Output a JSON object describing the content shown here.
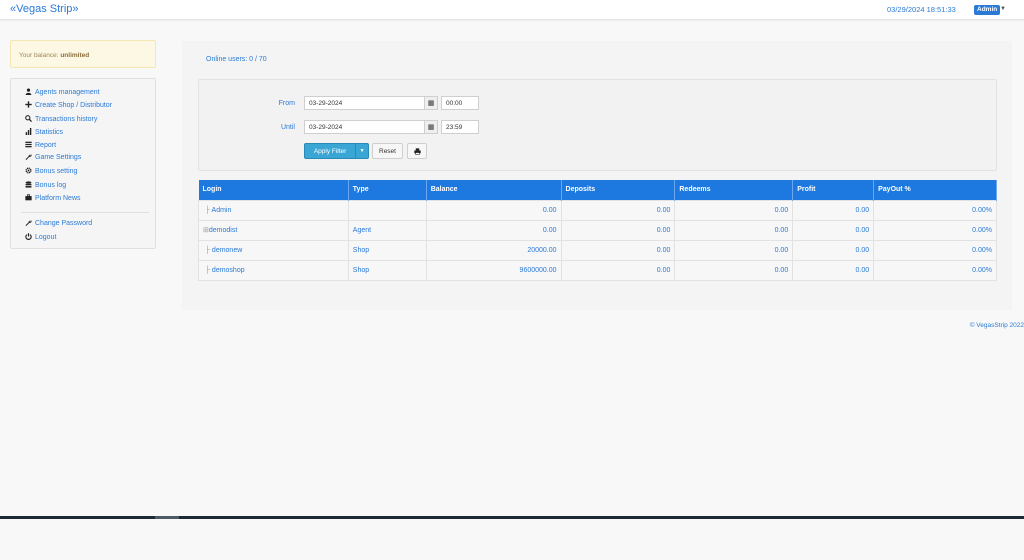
{
  "header": {
    "brand": "«Vegas Strip»",
    "datetime": "03/29/2024 18:51:33",
    "user_badge": "Admin"
  },
  "balance": {
    "label": "Your balance:",
    "value": "unlimited"
  },
  "sidebar": {
    "items": [
      {
        "label": "Agents management",
        "icon": "user-icon"
      },
      {
        "label": "Create Shop / Distributor",
        "icon": "plus-icon"
      },
      {
        "label": "Transactions history",
        "icon": "search-icon"
      },
      {
        "label": "Statistics",
        "icon": "bar-chart-icon"
      },
      {
        "label": "Report",
        "icon": "list-icon"
      },
      {
        "label": "Game Settings",
        "icon": "wrench-icon"
      },
      {
        "label": "Bonus setting",
        "icon": "gear-icon"
      },
      {
        "label": "Bonus log",
        "icon": "stack-icon"
      },
      {
        "label": "Platform News",
        "icon": "briefcase-icon"
      }
    ],
    "footer_items": [
      {
        "label": "Change Password",
        "icon": "wrench-icon"
      },
      {
        "label": "Logout",
        "icon": "power-icon"
      }
    ]
  },
  "main": {
    "online_users": "Online users: 0 / 70",
    "filter": {
      "from_label": "From",
      "from_date": "03-29-2024",
      "from_time": "00:00",
      "until_label": "Until",
      "until_date": "03-29-2024",
      "until_time": "23:59",
      "apply_label": "Apply Filter",
      "reset_label": "Reset"
    },
    "table": {
      "columns": [
        "Login",
        "Type",
        "Balance",
        "Deposits",
        "Redeems",
        "Profit",
        "PayOut %"
      ],
      "rows": [
        {
          "login": "Admin",
          "prefix": "├",
          "type": "",
          "balance": "0.00",
          "deposits": "0.00",
          "redeems": "0.00",
          "profit": "0.00",
          "payout": "0.00%"
        },
        {
          "login": "demodist",
          "prefix": "⊞",
          "type": "Agent",
          "balance": "0.00",
          "deposits": "0.00",
          "redeems": "0.00",
          "profit": "0.00",
          "payout": "0.00%"
        },
        {
          "login": "demonew",
          "prefix": "├",
          "type": "Shop",
          "balance": "20000.00",
          "deposits": "0.00",
          "redeems": "0.00",
          "profit": "0.00",
          "payout": "0.00%"
        },
        {
          "login": "demoshop",
          "prefix": "├",
          "type": "Shop",
          "balance": "9600000.00",
          "deposits": "0.00",
          "redeems": "0.00",
          "profit": "0.00",
          "payout": "0.00%"
        }
      ]
    }
  },
  "footer": {
    "copyright": "© VegasStrip 2022"
  }
}
